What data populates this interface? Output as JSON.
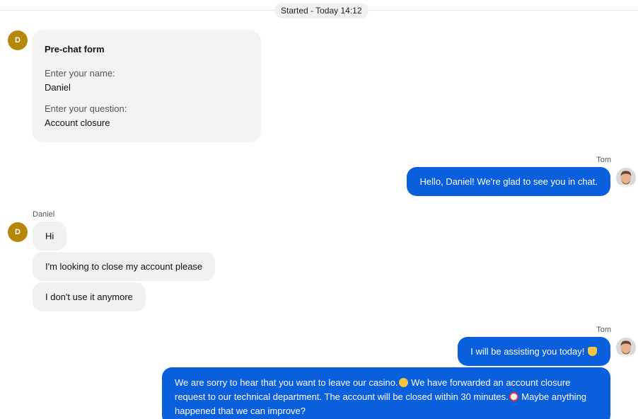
{
  "session": {
    "started_label": "Started - Today 14:12"
  },
  "visitor": {
    "initial": "D",
    "name": "Daniel"
  },
  "agent": {
    "name": "Tom"
  },
  "prechat_form": {
    "title": "Pre-chat form",
    "fields": [
      {
        "label": "Enter your name:",
        "value": "Daniel"
      },
      {
        "label": "Enter your question:",
        "value": "Account closure"
      }
    ]
  },
  "messages": {
    "agent_greeting": "Hello, Daniel! We're glad to see you in chat.",
    "visitor": [
      "Hi",
      "I'm looking to close my account please",
      "I don't use it anymore"
    ],
    "agent_assist": "I will be assisting you today!",
    "agent_reply_part1": "We are sorry to hear that you want to leave our casino.",
    "agent_reply_part2": " We have forwarded an account closure request to our technical department. The account will be closed within 30 minutes.",
    "agent_reply_part3": " Maybe anything happened that we can improve?"
  },
  "icons": {
    "assist_emoji": "yellow-heart-icon",
    "sad_emoji": "disappointed-face-icon",
    "clock_emoji": "alarm-clock-icon"
  },
  "colors": {
    "agent_bubble": "#0a5fdc",
    "visitor_bubble": "#f1f1f1",
    "visitor_avatar": "#b8860b"
  }
}
